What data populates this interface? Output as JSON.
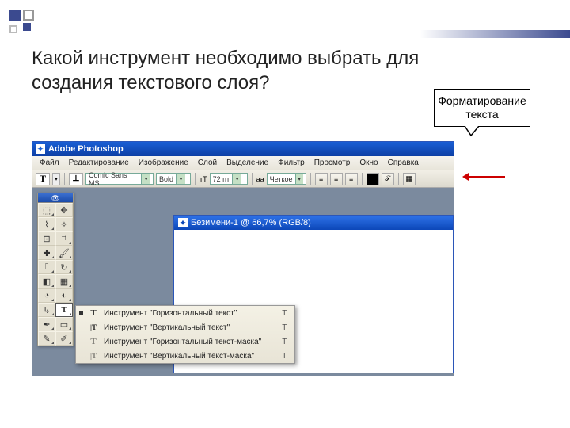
{
  "slide": {
    "question": "Какой инструмент необходимо выбрать для создания текстового слоя?",
    "callout": "Форматирование текста"
  },
  "ps": {
    "title": "Adobe Photoshop",
    "menu": [
      "Файл",
      "Редактирование",
      "Изображение",
      "Слой",
      "Выделение",
      "Фильтр",
      "Просмотр",
      "Окно",
      "Справка"
    ],
    "opt": {
      "font": "Comic Sans MS",
      "weight": "Bold",
      "size": "72 пт",
      "aa_label": "aa",
      "aa": "Четкое"
    },
    "doc_title": "Безимени-1 @ 66,7% (RGB/8)",
    "flyout": [
      {
        "sel": true,
        "icon": "T",
        "label": "Инструмент \"Горизонтальный текст\"",
        "key": "T"
      },
      {
        "sel": false,
        "icon": "|T",
        "label": "Инструмент \"Вертикальный текст\"",
        "key": "T"
      },
      {
        "sel": false,
        "icon": "T",
        "label": "Инструмент \"Горизонтальный текст-маска\"",
        "key": "T"
      },
      {
        "sel": false,
        "icon": "|T",
        "label": "Инструмент \"Вертикальный текст-маска\"",
        "key": "T"
      }
    ]
  }
}
